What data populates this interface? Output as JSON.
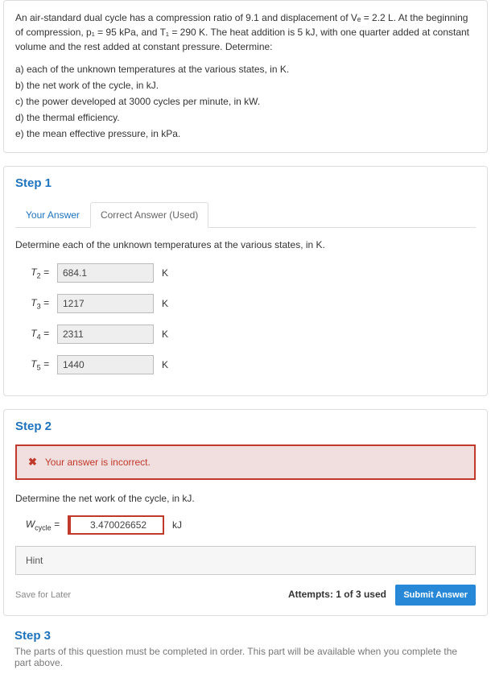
{
  "problem": {
    "intro": "An air-standard dual cycle has a compression ratio of 9.1 and displacement of Vₑ = 2.2 L. At the beginning of compression, p₁ = 95 kPa, and T₁ = 290 K. The heat addition is 5 kJ, with one quarter added at constant volume and the rest added at constant pressure. Determine:",
    "parts": [
      "a)   each of the unknown temperatures at the various states, in K.",
      "b)   the net work of the cycle, in kJ.",
      "c)   the power developed at 3000 cycles per minute, in kW.",
      "d)   the thermal efficiency.",
      "e)   the mean effective pressure, in kPa."
    ]
  },
  "step1": {
    "title": "Step 1",
    "tabs": {
      "your": "Your Answer",
      "correct": "Correct Answer (Used)"
    },
    "prompt": "Determine each of the unknown temperatures at the various states, in K.",
    "rows": [
      {
        "var": "T₂",
        "value": "684.1",
        "unit": "K"
      },
      {
        "var": "T₃",
        "value": "1217",
        "unit": "K"
      },
      {
        "var": "T₄",
        "value": "2311",
        "unit": "K"
      },
      {
        "var": "T₅",
        "value": "1440",
        "unit": "K"
      }
    ]
  },
  "step2": {
    "title": "Step 2",
    "error": "Your answer is incorrect.",
    "prompt": "Determine the net work of the cycle, in kJ.",
    "var": "W",
    "sub": "cycle",
    "value": "3.470026652",
    "unit": "kJ",
    "hint": "Hint",
    "save": "Save for Later",
    "attempts": "Attempts: 1 of 3 used",
    "submit": "Submit Answer"
  },
  "step3": {
    "title": "Step 3",
    "locked": "The parts of this question must be completed in order. This part will be available when you complete the part above."
  }
}
